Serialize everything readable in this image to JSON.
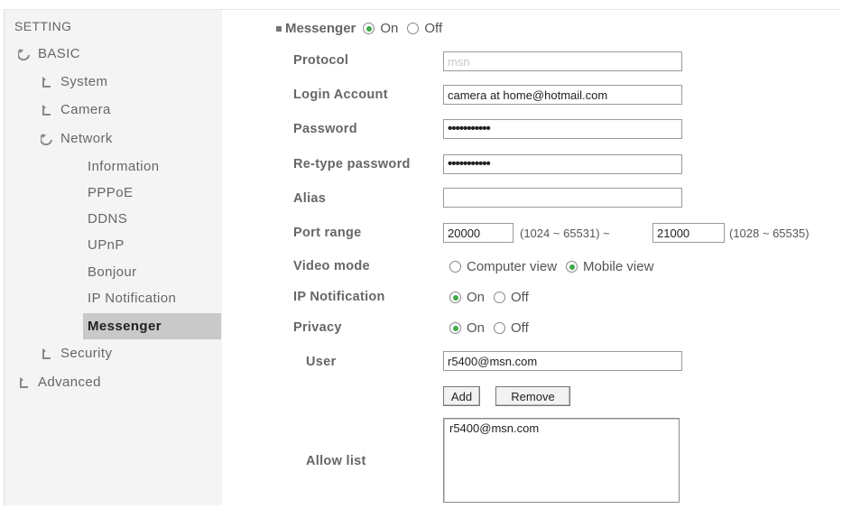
{
  "sidebar": {
    "title": "SETTING",
    "basic": "BASIC",
    "system": "System",
    "camera": "Camera",
    "network": "Network",
    "network_items": [
      "Information",
      "PPPoE",
      "DDNS",
      "UPnP",
      "Bonjour",
      "IP Notification",
      "Messenger"
    ],
    "active": "Messenger",
    "security": "Security",
    "advanced": "Advanced"
  },
  "messenger": {
    "label": "Messenger",
    "on": "On",
    "off": "Off",
    "enabled": true
  },
  "form": {
    "protocol_label": "Protocol",
    "protocol_value": "msn",
    "login_label": "Login Account",
    "login_value": "camera at home@hotmail.com",
    "password_label": "Password",
    "password_value": "•••••••••••",
    "retype_label": "Re-type password",
    "retype_value": "•••••••••••",
    "alias_label": "Alias",
    "alias_value": "",
    "port_label": "Port range",
    "port_from": "20000",
    "port_from_hint": "(1024 ~ 65531) ~",
    "port_to": "21000",
    "port_to_hint": "(1028 ~ 65535)",
    "video_label": "Video mode",
    "video_computer": "Computer view",
    "video_mobile": "Mobile view",
    "ipnotif_label": "IP Notification",
    "privacy_label": "Privacy",
    "on": "On",
    "off": "Off",
    "user_label": "User",
    "user_value": "r5400@msn.com",
    "add_label": "Add",
    "remove_label": "Remove",
    "allow_label": "Allow list",
    "allow_items": [
      "r5400@msn.com"
    ]
  }
}
